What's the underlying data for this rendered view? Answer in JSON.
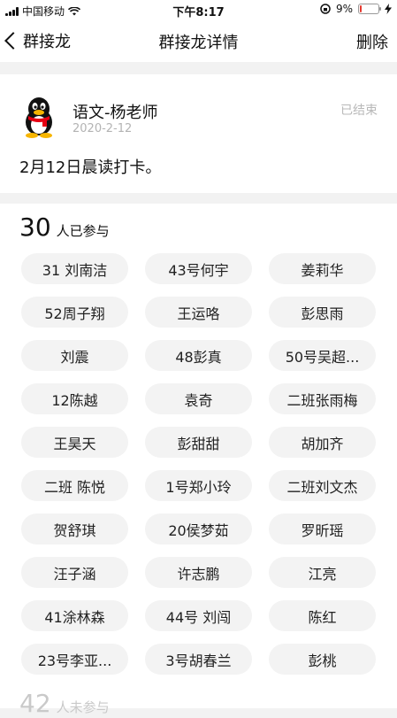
{
  "status_bar": {
    "carrier": "中国移动",
    "time": "下午8:17",
    "battery": "9%",
    "battery_level": 0.09
  },
  "nav": {
    "back_label": "群接龙",
    "title": "群接龙详情",
    "delete_label": "删除"
  },
  "post": {
    "author": "语文-杨老师",
    "date": "2020-2-12",
    "status": "已结束",
    "content": "2月12日晨读打卡。"
  },
  "participants": {
    "count": "30",
    "label": "人已参与",
    "names": [
      "31 刘南洁",
      "43号何宇",
      "姜莉华",
      "52周子翔",
      "王运咯",
      "彭思雨",
      "刘震",
      "48彭真",
      "50号吴超...",
      "12陈越",
      "袁奇",
      "二班张雨梅",
      "王昊天",
      "彭甜甜",
      "胡加齐",
      "二班 陈悦",
      "1号郑小玲",
      "二班刘文杰",
      "贺舒琪",
      "20侯梦茹",
      "罗昕瑶",
      "汪子涵",
      "许志鹏",
      "江亮",
      "41涂林森",
      "44号 刘闯",
      "陈红",
      "23号李亚...",
      "3号胡春兰",
      "彭桃"
    ]
  },
  "not_participated": {
    "count": "42",
    "label": "人未参与"
  }
}
